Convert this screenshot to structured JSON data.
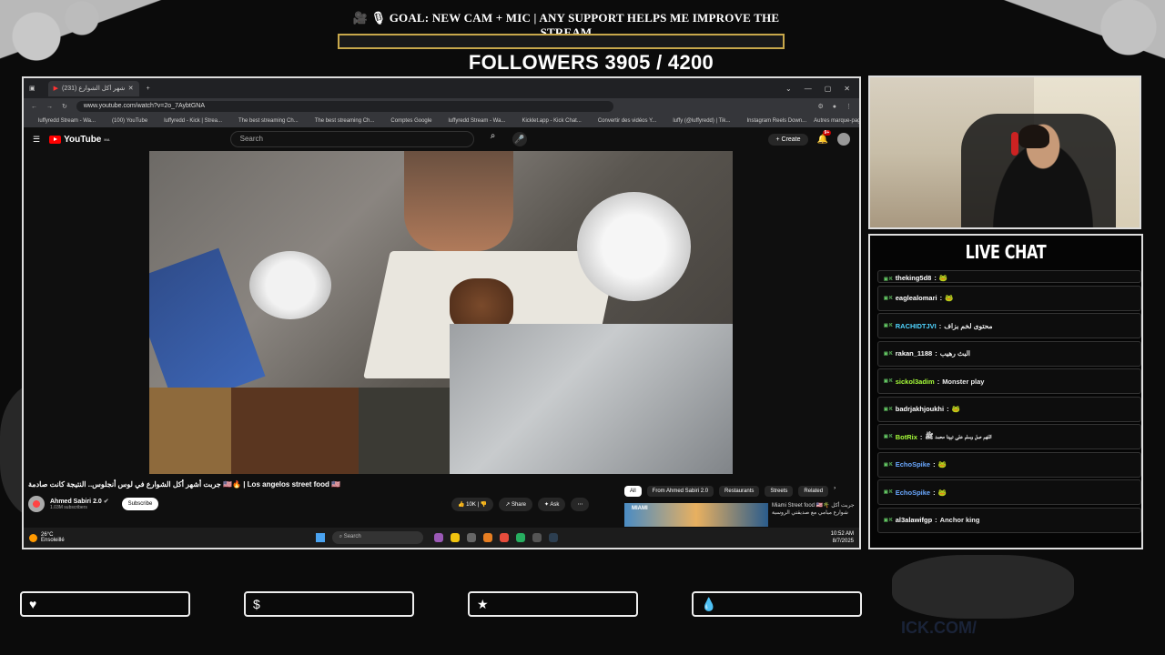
{
  "overlay": {
    "goal_text": "GOAL: NEW CAM + MIC | ANY SUPPORT HELPS ME IMPROVE THE STREAM",
    "goal_icons": "🎥 🎙",
    "goal_progress": 0,
    "followers_text": "FOLLOWERS 3905 / 4200",
    "watermark_text": "ICK.COM/"
  },
  "browser": {
    "tab_title": "جربت أشهر أكل الشوارع (231)",
    "url": "www.youtube.com/watch?v=2o_7AybtGNA",
    "bookmarks": [
      "luffyredd Stream - Wa...",
      "(100) YouTube",
      "luffyredd - Kick | Strea...",
      "The best streaming Ch...",
      "The best streaming Ch...",
      "Comptes Google",
      "luffyredd Stream - Wa...",
      "Kicklet.app - Kick Chat...",
      "Convertir des vidéos Y...",
      "luffy (@luffyredd) | Tik...",
      "Instagram Reels Down..."
    ],
    "bookmarks_more": "Autres marque-pages"
  },
  "youtube": {
    "logo_text": "YouTube",
    "logo_country": "MA",
    "search_placeholder": "Search",
    "create_label": "Create",
    "notif_count": "9+",
    "video_title": "جربت أشهر أكل الشوارع في لوس أنجلوس.. النتيجة كانت صادمة 🇺🇸🔥 | Los angelos street food 🇺🇸",
    "channel_name": "Ahmed Sabiri 2.0",
    "subscribers": "1.03M subscribers",
    "subscribe_label": "Subscribe",
    "likes": "10K",
    "share_label": "Share",
    "ask_label": "Ask",
    "chips": [
      "All",
      "From Ahmed Sabiri 2.0",
      "Restaurants",
      "Streets",
      "Related"
    ],
    "related_thumb_text": "MIAMI",
    "related_title": "Miami Street food 🇺🇸🌴 جربت أكل شوارع ميامي مع صديقتي الروسية"
  },
  "taskbar": {
    "temp": "26°C",
    "weather": "Ensoleillé",
    "search_placeholder": "Search",
    "time": "10:52 AM",
    "date": "8/7/2025"
  },
  "chat": {
    "header": "LIVE CHAT",
    "messages": [
      {
        "user": "theking5d8",
        "text": "🐸",
        "color": "#ffffff"
      },
      {
        "user": "eaglealomari",
        "text": "🐸",
        "color": "#ffffff"
      },
      {
        "user": "RACHIDTJVI",
        "text": "محتوى لخم بزاف",
        "color": "#4fd4ff"
      },
      {
        "user": "rakan_1188",
        "text": "البث رهيب",
        "color": "#ffffff"
      },
      {
        "user": "sickol3adim",
        "text": "Monster play",
        "color": "#a8ff3a"
      },
      {
        "user": "badrjakhjoukhi",
        "text": "🐸",
        "color": "#ffffff"
      },
      {
        "user": "BotRix",
        "text": "اللهم صل وسلم على نبينا محمد ﷺ",
        "color": "#a8ff3a"
      },
      {
        "user": "EchoSpike",
        "text": "🐸",
        "color": "#6aa8ff"
      },
      {
        "user": "EchoSpike",
        "text": "🐸",
        "color": "#6aa8ff"
      },
      {
        "user": "al3alawifgp",
        "text": "Anchor king",
        "color": "#ffffff"
      }
    ]
  },
  "support_buttons": [
    {
      "icon": "heart-icon",
      "glyph": "♥"
    },
    {
      "icon": "dollar-icon",
      "glyph": "$"
    },
    {
      "icon": "star-icon",
      "glyph": "★"
    },
    {
      "icon": "drop-icon",
      "glyph": "💧"
    }
  ]
}
